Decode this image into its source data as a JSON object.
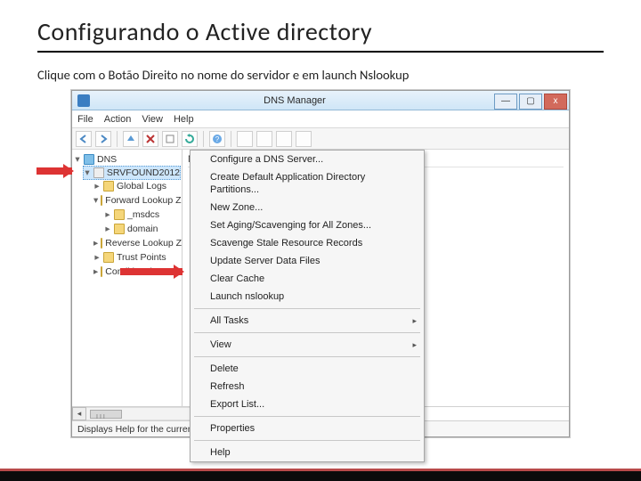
{
  "slide": {
    "title": "Configurando  o Active directory",
    "subtitle": "Clique com o Botão Direito no nome do servidor e em launch Nslookup"
  },
  "window": {
    "title": "DNS Manager",
    "buttons": {
      "min": "—",
      "max": "▢",
      "close": "x"
    }
  },
  "menubar": [
    "File",
    "Action",
    "View",
    "Help"
  ],
  "tree": {
    "root": "DNS",
    "server": "SRVFOUND2012",
    "children": [
      "Global Logs",
      "Forward Lookup Zones",
      "_msdcs",
      "domain",
      "Reverse Lookup Zones",
      "Trust Points",
      "Conditional Forwarders"
    ]
  },
  "list": {
    "header": "Name"
  },
  "context_menu": {
    "items": [
      {
        "label": "Configure a DNS Server..."
      },
      {
        "label": "Create Default Application Directory Partitions..."
      },
      {
        "label": "New Zone..."
      },
      {
        "label": "Set Aging/Scavenging for All Zones..."
      },
      {
        "label": "Scavenge Stale Resource Records"
      },
      {
        "label": "Update Server Data Files"
      },
      {
        "label": "Clear Cache"
      },
      {
        "label": "Launch nslookup"
      },
      {
        "sep": true
      },
      {
        "label": "All Tasks",
        "arrow": true
      },
      {
        "sep": true
      },
      {
        "label": "View",
        "arrow": true
      },
      {
        "sep": true
      },
      {
        "label": "Delete"
      },
      {
        "label": "Refresh"
      },
      {
        "label": "Export List..."
      },
      {
        "sep": true
      },
      {
        "label": "Properties"
      },
      {
        "sep": true
      },
      {
        "label": "Help"
      }
    ]
  },
  "scroll": {
    "thumb_label": "III"
  },
  "status": "Displays Help for the current selection."
}
